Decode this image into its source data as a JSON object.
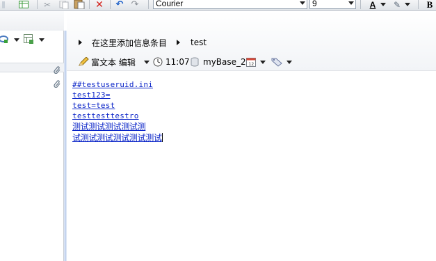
{
  "toolbar": {
    "font_name": "Courier",
    "font_size": "9",
    "font_color_label": "A",
    "bold_label": "B"
  },
  "breadcrumb": {
    "placeholder_item": "在这里添加信息条目",
    "current_item": "test"
  },
  "note_toolbar": {
    "edit_mode_label": "富文本 编辑",
    "time": "11:07",
    "database": "myBase_2"
  },
  "editor": {
    "lines": [
      "##testuseruid.ini",
      "test123=",
      "test=test",
      "testtesttestro",
      "测试测试测试测试测",
      "试测试测试测试测试测试"
    ]
  },
  "colors": {
    "link_text": "#0b25c8",
    "splitter": "#b9ccec"
  }
}
